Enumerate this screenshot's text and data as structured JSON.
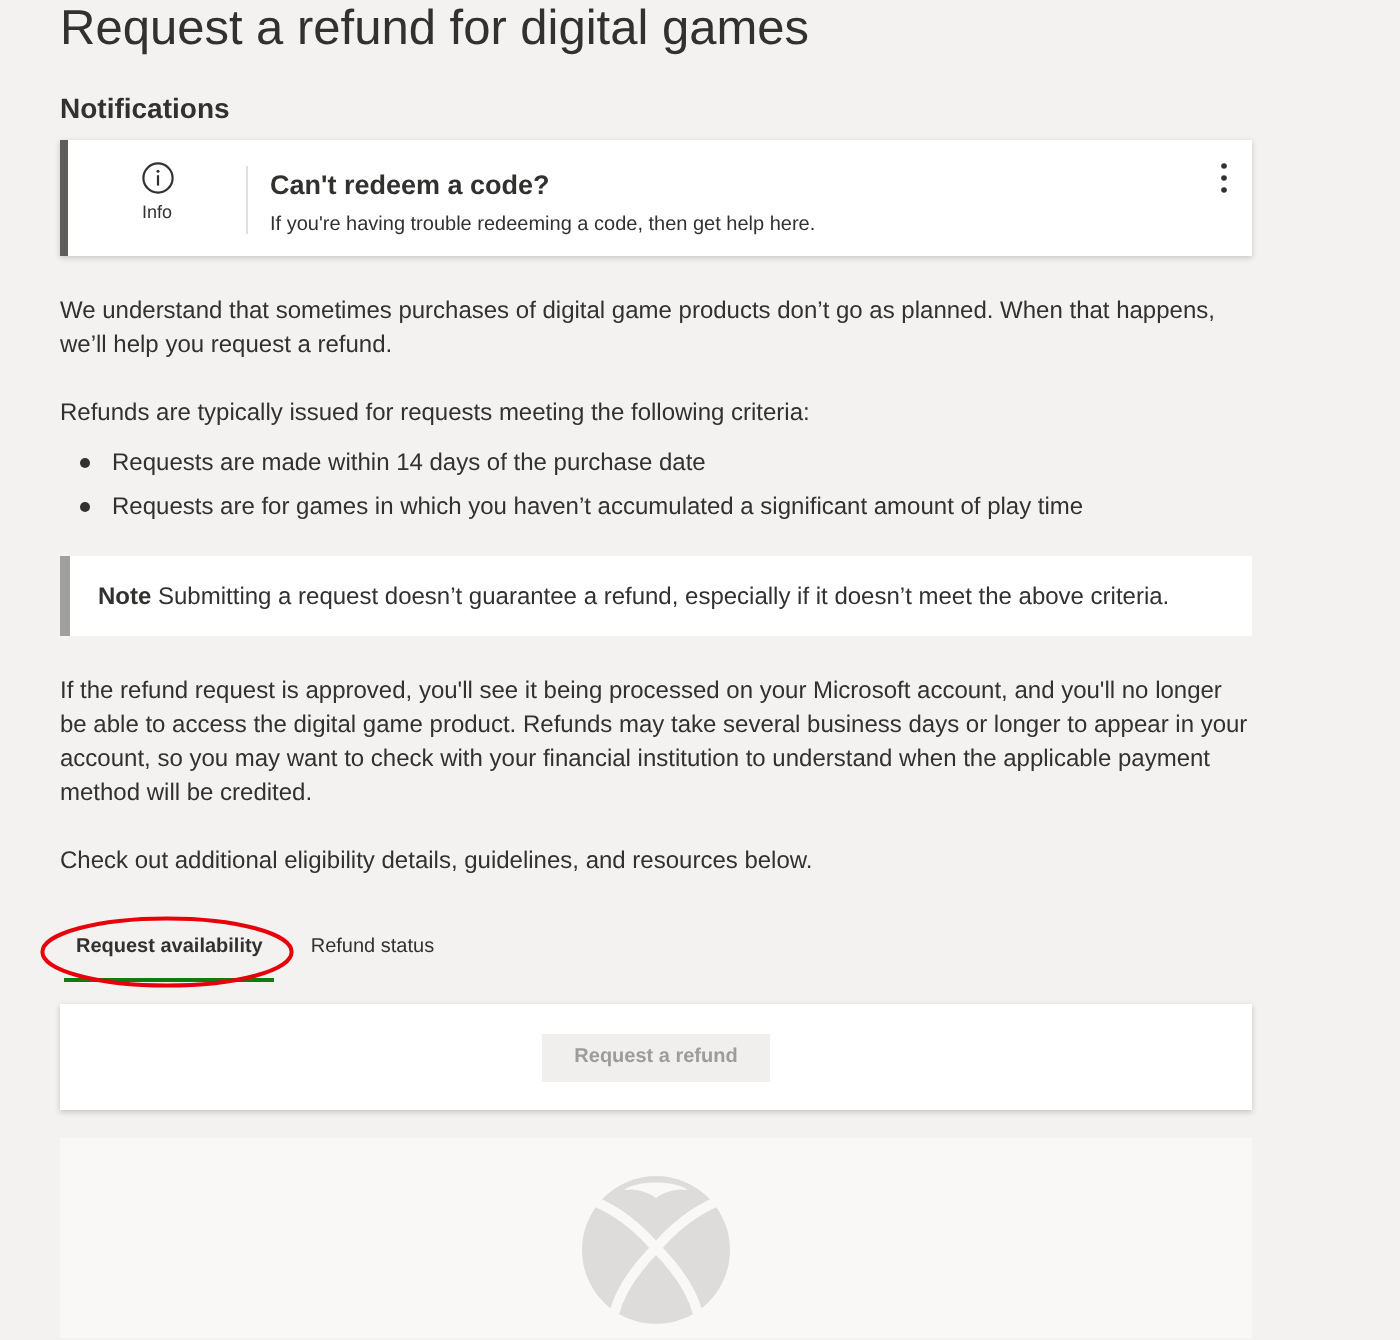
{
  "page": {
    "title": "Request a refund for digital games"
  },
  "notifications": {
    "heading": "Notifications",
    "items": [
      {
        "kind": "info",
        "badge_label": "Info",
        "title": "Can't redeem a code?",
        "message": "If you're having trouble redeeming a code, then get help here."
      }
    ]
  },
  "intro": "We understand that sometimes purchases of digital game products don’t go as planned. When that happens, we’ll help you request a refund.",
  "criteria": {
    "lead": "Refunds are typically issued for requests meeting the following criteria:",
    "items": [
      "Requests are made within 14 days of the purchase date",
      "Requests are for games in which you haven’t accumulated a significant amount of play time"
    ]
  },
  "note": "**Note** Submitting a request doesn’t guarantee a refund, especially if it doesn’t meet the above criteria.",
  "paragraphs": [
    "If the refund request is approved, you'll see it being processed on your Microsoft account, and you'll no longer be able to access the digital game product. Refunds may take several business days or longer to appear in your account, so you may want to check with your financial institution to understand when the applicable payment method will be credited.",
    "Check out additional eligibility details, guidelines, and resources below."
  ],
  "tabs": [
    {
      "label": "Request availability",
      "selected": true,
      "circled": true
    },
    {
      "label": "Refund status",
      "selected": false,
      "circled": false
    }
  ],
  "action_card": {
    "button": {
      "label": "Request a refund",
      "disabled": true
    }
  }
}
